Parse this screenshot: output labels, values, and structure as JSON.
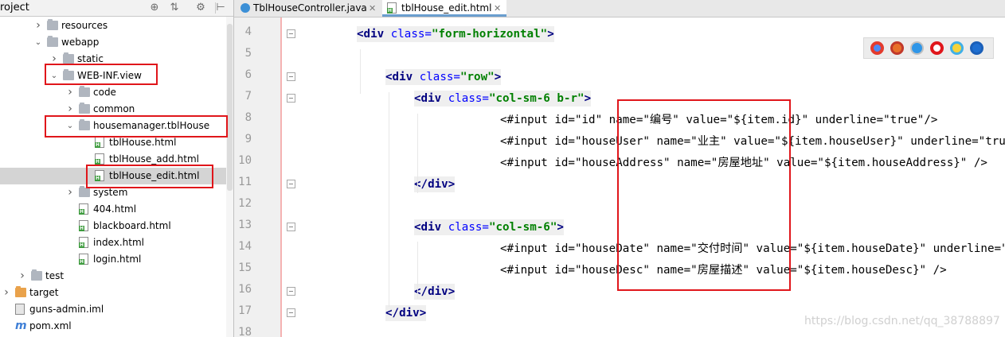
{
  "project_panel": {
    "title": "roject",
    "header_icons": [
      "target-icon",
      "collapse-icon",
      "gear-icon",
      "hide-icon"
    ],
    "tree": [
      {
        "label": "resources",
        "icon": "folder",
        "expanded": false
      },
      {
        "label": "webapp",
        "icon": "folder",
        "expanded": true
      },
      {
        "label": "static",
        "icon": "folder",
        "expanded": false
      },
      {
        "label": "WEB-INF.view",
        "icon": "folder",
        "expanded": true
      },
      {
        "label": "code",
        "icon": "folder",
        "expanded": false
      },
      {
        "label": "common",
        "icon": "folder",
        "expanded": false
      },
      {
        "label": "housemanager.tblHouse",
        "icon": "folder",
        "expanded": true
      },
      {
        "label": "tblHouse.html",
        "icon": "html"
      },
      {
        "label": "tblHouse_add.html",
        "icon": "html"
      },
      {
        "label": "tblHouse_edit.html",
        "icon": "html",
        "selected": true
      },
      {
        "label": "system",
        "icon": "folder",
        "expanded": false
      },
      {
        "label": "404.html",
        "icon": "html"
      },
      {
        "label": "blackboard.html",
        "icon": "html"
      },
      {
        "label": "index.html",
        "icon": "html"
      },
      {
        "label": "login.html",
        "icon": "html"
      },
      {
        "label": "test",
        "icon": "folder",
        "expanded": false
      },
      {
        "label": "target",
        "icon": "folder-orange",
        "expanded": false
      },
      {
        "label": "guns-admin.iml",
        "icon": "iml"
      },
      {
        "label": "pom.xml",
        "icon": "maven"
      }
    ]
  },
  "editor": {
    "tabs": [
      {
        "label": "TblHouseController.java",
        "icon": "java-class-icon",
        "active": false
      },
      {
        "label": "tblHouse_edit.html",
        "icon": "html-file-icon",
        "active": true
      }
    ],
    "line_numbers": [
      "4",
      "5",
      "6",
      "7",
      "8",
      "9",
      "10",
      "11",
      "12",
      "13",
      "14",
      "15",
      "16",
      "17",
      "18"
    ],
    "code_lines": [
      [
        {
          "t": "<div",
          "c": "tag"
        },
        {
          "t": " "
        },
        {
          "t": "class=",
          "c": "attr"
        },
        {
          "t": "\"form-horizontal\"",
          "c": "str"
        },
        {
          "t": ">",
          "c": "tag"
        }
      ],
      [],
      [
        {
          "t": "<div",
          "c": "tag"
        },
        {
          "t": " "
        },
        {
          "t": "class=",
          "c": "attr"
        },
        {
          "t": "\"row\"",
          "c": "str"
        },
        {
          "t": ">",
          "c": "tag"
        }
      ],
      [
        {
          "t": "<div",
          "c": "tag"
        },
        {
          "t": " "
        },
        {
          "t": "class=",
          "c": "attr"
        },
        {
          "t": "\"col-sm-6 b-r\"",
          "c": "str"
        },
        {
          "t": ">",
          "c": "tag"
        }
      ],
      [
        {
          "t": "<#input id=\"id\" name=\"编号\" value=\"${item.id}\" underline=\"true\"/>"
        }
      ],
      [
        {
          "t": "<#input id=\"houseUser\" name=\"业主\" value=\"${item.houseUser}\" underline=\"true\"/>"
        }
      ],
      [
        {
          "t": "<#input id=\"houseAddress\" name=\"房屋地址\" value=\"${item.houseAddress}\" />"
        }
      ],
      [
        {
          "t": "</div",
          "c": "tag"
        },
        {
          "t": ">",
          "c": "tag"
        }
      ],
      [],
      [
        {
          "t": "<div",
          "c": "tag"
        },
        {
          "t": " "
        },
        {
          "t": "class=",
          "c": "attr"
        },
        {
          "t": "\"col-sm-6\"",
          "c": "str"
        },
        {
          "t": ">",
          "c": "tag"
        }
      ],
      [
        {
          "t": "<#input id=\"houseDate\" name=\"交付时间\" value=\"${item.houseDate}\" underline=\"true\"/>"
        }
      ],
      [
        {
          "t": "<#input id=\"houseDesc\" name=\"房屋描述\" value=\"${item.houseDesc}\" />"
        }
      ],
      [
        {
          "t": "</div",
          "c": "tag"
        },
        {
          "t": ">",
          "c": "tag"
        }
      ],
      [
        {
          "t": "</div",
          "c": "tag"
        },
        {
          "t": ">",
          "c": "tag"
        }
      ],
      []
    ],
    "browser_icons": [
      "chrome-icon",
      "firefox-icon",
      "safari-icon",
      "opera-icon",
      "ie-icon",
      "edge-icon"
    ]
  },
  "watermark": "https://blog.csdn.net/qq_38788897",
  "colors": {
    "highlight_box": "#e0161b",
    "tag": "#000080",
    "attr": "#0000ff",
    "string": "#008000"
  }
}
